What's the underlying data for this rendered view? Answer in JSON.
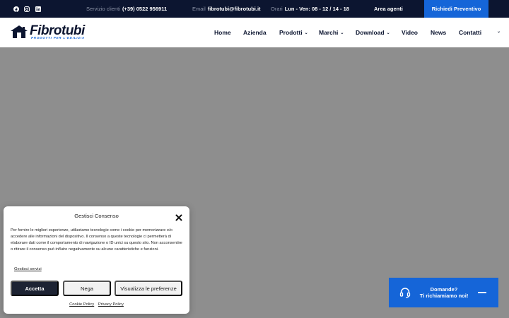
{
  "topbar": {
    "phone_label": "Servizio clienti",
    "phone_value": "(+39) 0522 956911",
    "email_label": "Email",
    "email_value": "fibrotubi@fibrotubi.it",
    "hours_label": "Orari",
    "hours_value": "Lun - Ven: 08 - 12 / 14 - 18",
    "area_agenti": "Area agenti",
    "preventivo": "Richiedi Preventivo",
    "social_icons": [
      "facebook-icon",
      "instagram-icon",
      "linkedin-icon"
    ]
  },
  "header": {
    "logo_brand": "Fibrotubi",
    "logo_tagline": "PRODOTTI PER L'EDILIZIA",
    "nav": {
      "home": "Home",
      "azienda": "Azienda",
      "prodotti": "Prodotti",
      "marchi": "Marchi",
      "download": "Download",
      "video": "Video",
      "news": "News",
      "contatti": "Contatti"
    }
  },
  "consent": {
    "title": "Gestisci Consenso",
    "text": "Per fornire le migliori esperienze, utilizziamo tecnologie come i cookie per memorizzare e/o accedere alle informazioni del dispositivo. Il consenso a queste tecnologie ci permetterà di elaborare dati come il comportamento di navigazione o ID unici su questo sito. Non acconsentire o ritirare il consenso può influire negativamente su alcune caratteristiche e funzioni.",
    "services": "Gestisci servizi",
    "accept": "Accetta",
    "deny": "Nega",
    "preferences": "Visualizza le preferenze",
    "cookie_policy": "Cookie Policy",
    "privacy_policy": "Privacy Policy"
  },
  "callback": {
    "line1": "Domande?",
    "line2": "Ti richiamiamo noi!"
  },
  "colors": {
    "topbar_bg": "#0c1530",
    "accent_blue": "#1565d8",
    "hero_bg": "#8e8e8e",
    "accept_bg": "#1d2333"
  }
}
